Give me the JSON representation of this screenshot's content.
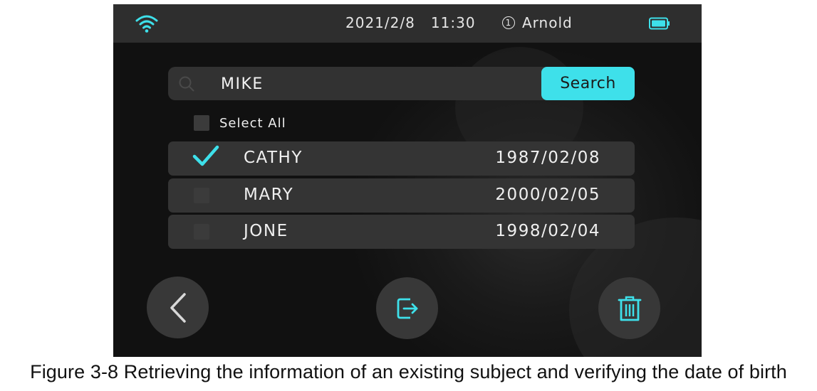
{
  "status_bar": {
    "date": "2021/2/8",
    "time": "11:30",
    "user_number": "1",
    "user_name": "Arnold",
    "wifi_icon": "wifi-icon",
    "battery_icon": "battery-icon"
  },
  "search": {
    "value": "MIKE",
    "button_label": "Search",
    "icon": "search-icon"
  },
  "select_all": {
    "label": "Select All",
    "checked": false
  },
  "records": [
    {
      "name": "CATHY",
      "dob": "1987/02/08",
      "checked": true
    },
    {
      "name": "MARY",
      "dob": "2000/02/05",
      "checked": false
    },
    {
      "name": "JONE",
      "dob": "1998/02/04",
      "checked": false
    }
  ],
  "actions": {
    "back_icon": "chevron-left-icon",
    "export_icon": "export-icon",
    "delete_icon": "trash-icon"
  },
  "colors": {
    "accent": "#3ee0ea",
    "row_bg": "#343434",
    "status_bar_bg": "#2e2e2e"
  },
  "caption": "Figure 3-8 Retrieving the information of an existing subject and verifying the date of birth"
}
